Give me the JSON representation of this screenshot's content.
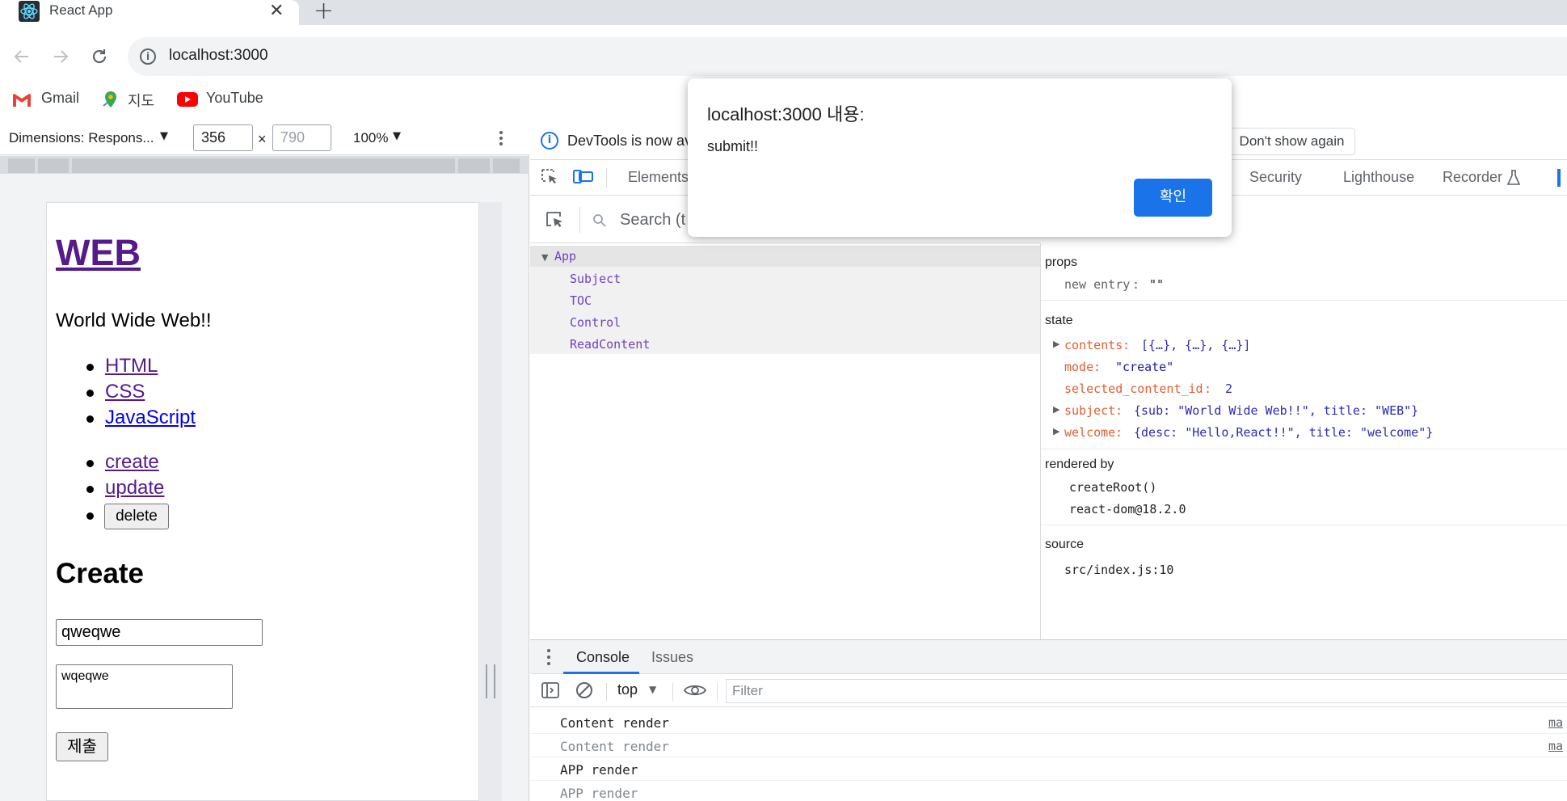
{
  "browser": {
    "tab_title": "React App",
    "tab_close": "✕",
    "new_tab": "+",
    "url": "localhost:3000",
    "bookmarks": [
      "Gmail",
      "지도",
      "YouTube"
    ]
  },
  "device_toolbar": {
    "dimensions_label": "Dimensions: Respons...",
    "width": "356",
    "height_placeholder": "790",
    "times": "×",
    "zoom": "100%"
  },
  "page": {
    "title": "WEB",
    "subtitle": "World Wide Web!!",
    "toc": [
      "HTML",
      "CSS",
      "JavaScript"
    ],
    "controls": [
      "create",
      "update"
    ],
    "delete_label": "delete",
    "form_heading": "Create",
    "title_value": "qweqwe",
    "desc_value": "wqeqwe",
    "submit_label": "제출"
  },
  "devtools": {
    "info_text": "DevTools is now av",
    "dont_show": "Don't show again",
    "tabs": [
      "Elements",
      "Security",
      "Lighthouse",
      "Recorder"
    ],
    "search_placeholder": "Search (t",
    "tree": {
      "root": "App",
      "children": [
        "Subject",
        "TOC",
        "Control",
        "ReadContent"
      ]
    },
    "props": {
      "title": "props",
      "new_entry_key": "new entry",
      "new_entry_val": "\"\""
    },
    "state": {
      "title": "state",
      "rows": [
        {
          "key": "contents",
          "val": "[{…}, {…}, {…}]"
        },
        {
          "key": "mode",
          "val": "\"create\""
        },
        {
          "key": "selected_content_id",
          "val": "2"
        },
        {
          "key": "subject",
          "val": "{sub: \"World Wide Web!!\", title: \"WEB\"}"
        },
        {
          "key": "welcome",
          "val": "{desc: \"Hello,React!!\", title: \"welcome\"}"
        }
      ]
    },
    "rendered_by": {
      "title": "rendered by",
      "items": [
        "createRoot()",
        "react-dom@18.2.0"
      ]
    },
    "source": {
      "title": "source",
      "value": "src/index.js:10"
    },
    "console": {
      "tabs": [
        "Console",
        "Issues"
      ],
      "context": "top",
      "filter_placeholder": "Filter",
      "logs": [
        {
          "text": "Content render",
          "link": "ma"
        },
        {
          "text": "Content render",
          "link": "ma"
        },
        {
          "text": "APP render",
          "link": ""
        },
        {
          "text": "APP render",
          "link": ""
        }
      ]
    }
  },
  "alert": {
    "title": "localhost:3000 내용:",
    "message": "submit!!",
    "ok_label": "확인"
  },
  "colors": {
    "accent": "#1a73e8",
    "link_visited": "#551a8b",
    "state_key": "#e35d31",
    "component": "#6f42c1"
  }
}
